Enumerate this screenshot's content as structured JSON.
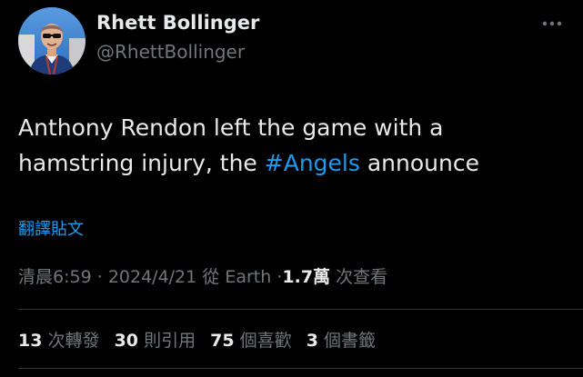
{
  "author": {
    "display_name": "Rhett Bollinger",
    "handle": "@RhettBollinger"
  },
  "menu": {
    "more_icon": "more-horizontal-icon"
  },
  "tweet": {
    "text_before": "Anthony Rendon left the game with a hamstring injury, the ",
    "hashtag": "#Angels",
    "text_after": " announce"
  },
  "translate_label": "翻譯貼文",
  "meta": {
    "time": "清晨6:59",
    "separator": "·",
    "date": "2024/4/21",
    "location": "從 Earth",
    "views_count": "1.7萬",
    "views_label": "次查看"
  },
  "stats": {
    "reposts_count": "13",
    "reposts_label": "次轉發",
    "quotes_count": "30",
    "quotes_label": "則引用",
    "likes_count": "75",
    "likes_label": "個喜歡",
    "bookmarks_count": "3",
    "bookmarks_label": "個書籤"
  },
  "colors": {
    "background": "#000000",
    "text": "#e7e9ea",
    "secondary": "#71767b",
    "accent": "#1d9bf0",
    "divider": "#2f3336"
  }
}
